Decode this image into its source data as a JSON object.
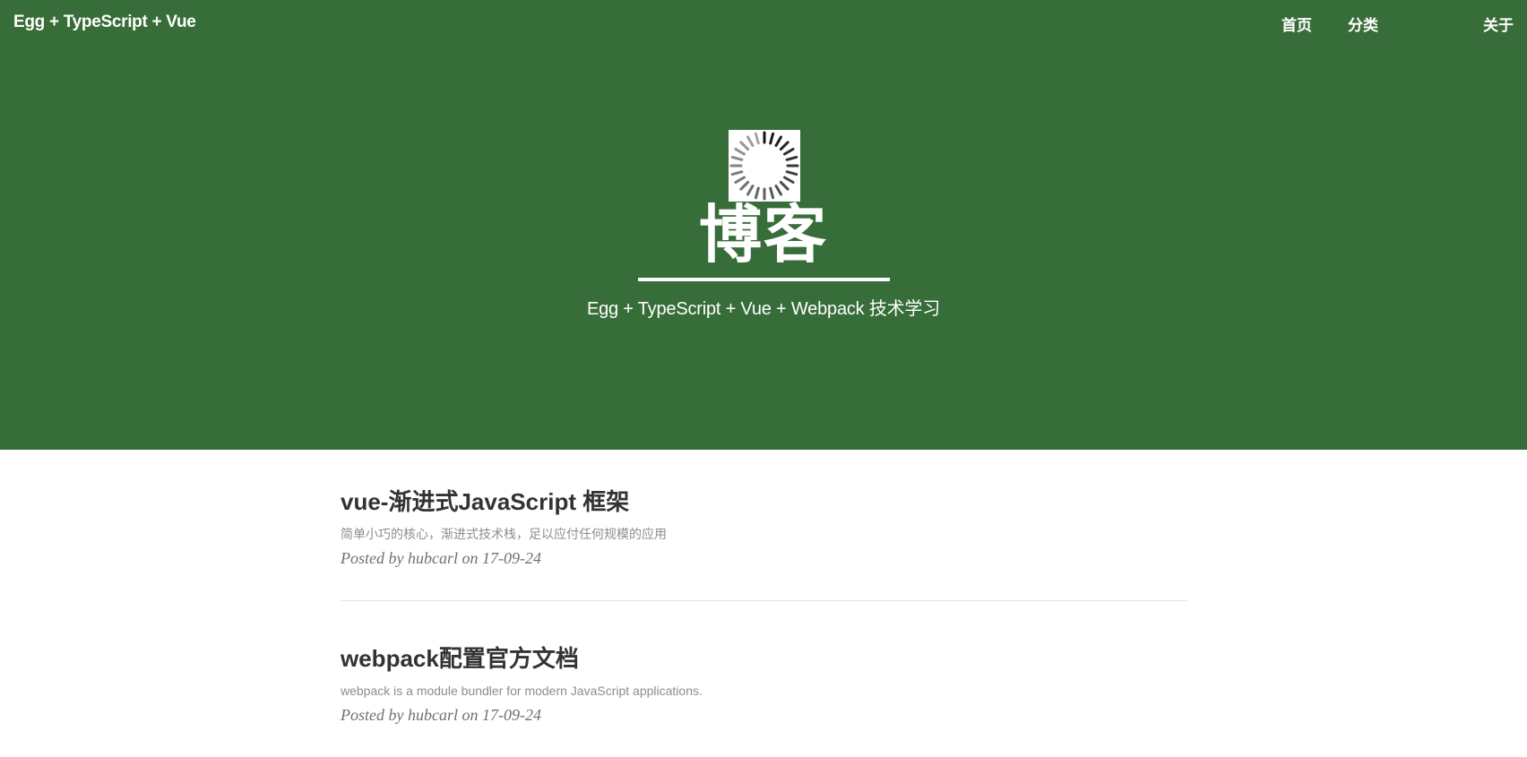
{
  "navbar": {
    "brand": "Egg + TypeScript + Vue",
    "links": [
      {
        "label": "首页"
      },
      {
        "label": "分类"
      },
      {
        "label": "关于"
      }
    ]
  },
  "hero": {
    "logo_icon": "spinner-icon",
    "title": "博客",
    "subtitle": "Egg + TypeScript + Vue + Webpack 技术学习",
    "background_color": "#376d38"
  },
  "posts": [
    {
      "title": "vue-渐进式JavaScript 框架",
      "summary": "简单小巧的核心，渐进式技术栈，足以应付任何规模的应用",
      "meta": "Posted by hubcarl on 17-09-24"
    },
    {
      "title": "webpack配置官方文档",
      "summary": "webpack is a module bundler for modern JavaScript applications.",
      "meta": "Posted by hubcarl on 17-09-24"
    }
  ]
}
